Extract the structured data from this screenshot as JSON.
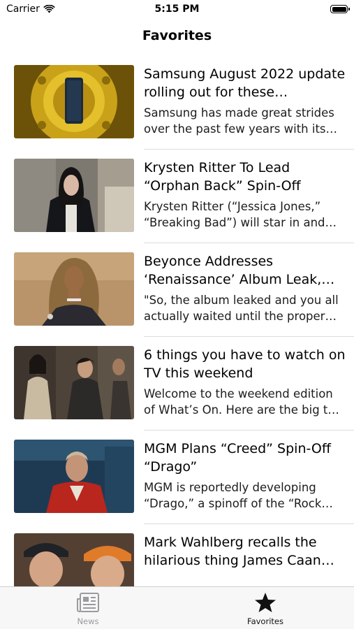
{
  "status": {
    "carrier": "Carrier",
    "time": "5:15 PM"
  },
  "nav": {
    "title": "Favorites"
  },
  "articles": [
    {
      "title": "Samsung August 2022 update rolling out for these…",
      "description": "Samsung has made great strides over the past few years with its…"
    },
    {
      "title": "Krysten Ritter To Lead “Orphan Back” Spin-Off",
      "description": "Krysten Ritter (“Jessica Jones,” “Breaking Bad”) will star in and…"
    },
    {
      "title": "Beyonce Addresses ‘Renaissance’ Album Leak,…",
      "description": "\"So, the album leaked and you all actually waited until the proper…"
    },
    {
      "title": "6 things you have to watch on TV this weekend",
      "description": "Welcome to the weekend edition of What’s On. Here are the big t…"
    },
    {
      "title": "MGM Plans “Creed” Spin-Off “Drago”",
      "description": "MGM is reportedly developing “Drago,” a spinoff of the “Rock…"
    },
    {
      "title": "Mark Wahlberg recalls the hilarious thing James Caan…",
      "description": ""
    }
  ],
  "tabs": [
    {
      "label": "News",
      "icon": "newspaper-icon",
      "selected": false
    },
    {
      "label": "Favorites",
      "icon": "star-icon",
      "selected": true
    }
  ],
  "colors": {
    "tab_selected": "#111111",
    "tab_unselected": "#9a9a9f",
    "separator": "#dcdcdf"
  }
}
